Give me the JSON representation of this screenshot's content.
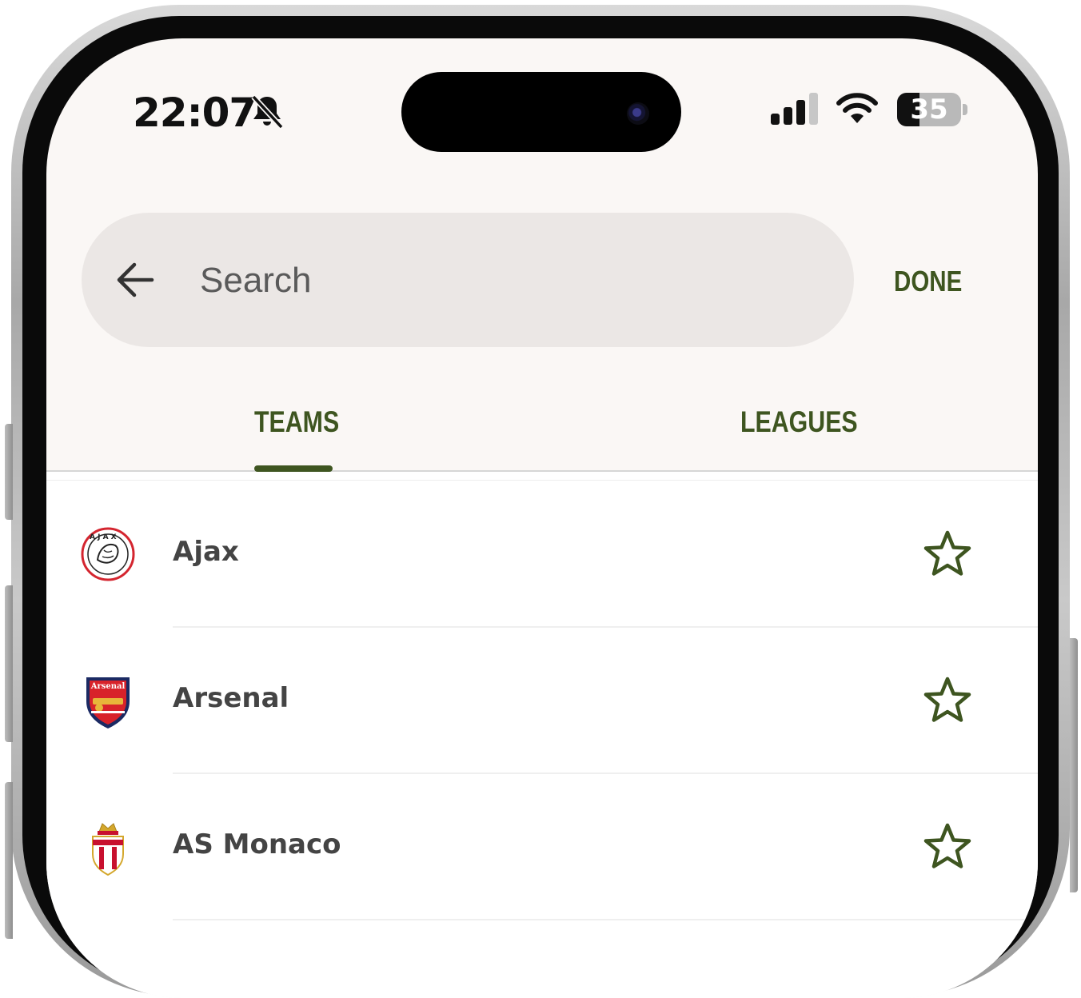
{
  "status_bar": {
    "time": "22:07",
    "battery": "35"
  },
  "search": {
    "placeholder": "Search",
    "value": "",
    "done_label": "DONE"
  },
  "tabs": [
    {
      "label": "TEAMS",
      "selected": true
    },
    {
      "label": "LEAGUES",
      "selected": false
    }
  ],
  "teams": [
    {
      "name": "Ajax",
      "crest": "ajax-crest-icon"
    },
    {
      "name": "Arsenal",
      "crest": "arsenal-crest-icon"
    },
    {
      "name": "AS Monaco",
      "crest": "monaco-crest-icon"
    }
  ],
  "colors": {
    "accent": "#3e5520",
    "background": "#faf7f5",
    "search_bg": "#ebe7e5"
  }
}
